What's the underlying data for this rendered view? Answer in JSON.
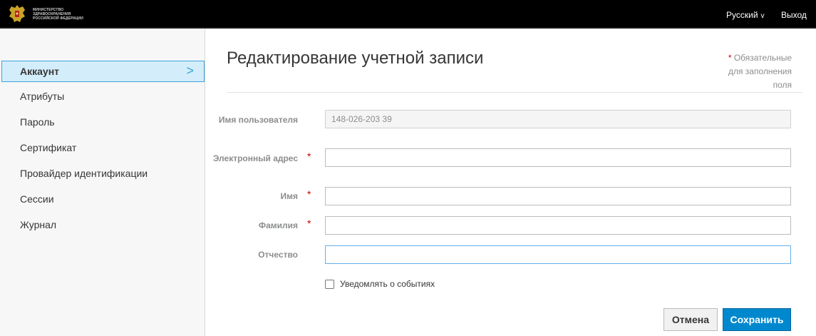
{
  "header": {
    "logo_text": "МИНИСТЕРСТВО ЗДРАВООХРАНЕНИЯ РОССИЙСКОЙ ФЕДЕРАЦИИ",
    "language": "Русский",
    "language_caret": "v",
    "logout": "Выход"
  },
  "sidebar": {
    "items": [
      {
        "label": "Аккаунт"
      },
      {
        "label": "Атрибуты"
      },
      {
        "label": "Пароль"
      },
      {
        "label": "Сертификат"
      },
      {
        "label": "Провайдер идентификации"
      },
      {
        "label": "Сессии"
      },
      {
        "label": "Журнал"
      }
    ],
    "active_chevron": ">"
  },
  "main": {
    "title": "Редактирование учетной записи",
    "required_star": "*",
    "required_note": "Обязательные для заполнения поля",
    "fields": {
      "username": {
        "label": "Имя пользователя",
        "value": "148-026-203 39"
      },
      "email": {
        "label": "Электронный адрес",
        "value": "",
        "star": "*"
      },
      "first_name": {
        "label": "Имя",
        "value": "",
        "star": "*"
      },
      "last_name": {
        "label": "Фамилия",
        "value": "",
        "star": "*"
      },
      "middle_name": {
        "label": "Отчество",
        "value": ""
      }
    },
    "notify_label": "Уведомлять о событиях",
    "cancel_label": "Отмена",
    "save_label": "Сохранить"
  },
  "colors": {
    "header_bg": "#000000",
    "active_nav_bg": "#d4edfa",
    "active_nav_border": "#39a5dc",
    "primary": "#0088ce",
    "required": "#cc0000"
  }
}
